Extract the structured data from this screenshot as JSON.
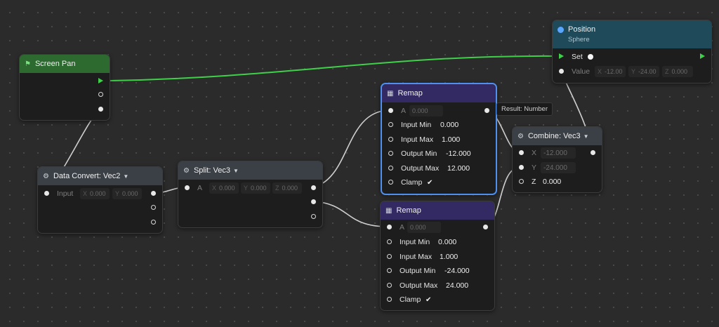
{
  "nodes": {
    "screen_pan": {
      "title": "Screen Pan"
    },
    "data_convert": {
      "title": "Data Convert: Vec2",
      "input_label": "Input",
      "x_label": "X",
      "x_value": "0.000",
      "y_label": "Y",
      "y_value": "0.000"
    },
    "split": {
      "title": "Split: Vec3",
      "a_label": "A",
      "x_label": "X",
      "x_value": "0.000",
      "y_label": "Y",
      "y_value": "0.000",
      "z_label": "Z",
      "z_value": "0.000"
    },
    "remap1": {
      "title": "Remap",
      "a_label": "A",
      "a_value": "0.000",
      "input_min_label": "Input Min",
      "input_min": "0.000",
      "input_max_label": "Input Max",
      "input_max": "1.000",
      "output_min_label": "Output Min",
      "output_min": "-12.000",
      "output_max_label": "Output Max",
      "output_max": "12.000",
      "clamp_label": "Clamp",
      "clamp_check": "✔"
    },
    "remap2": {
      "title": "Remap",
      "a_label": "A",
      "a_value": "0.000",
      "input_min_label": "Input Min",
      "input_min": "0.000",
      "input_max_label": "Input Max",
      "input_max": "1.000",
      "output_min_label": "Output Min",
      "output_min": "-24.000",
      "output_max_label": "Output Max",
      "output_max": "24.000",
      "clamp_label": "Clamp",
      "clamp_check": "✔"
    },
    "combine": {
      "title": "Combine: Vec3",
      "x_label": "X",
      "x_value": "-12.000",
      "y_label": "Y",
      "y_value": "-24.000",
      "z_label": "Z",
      "z_value": "0.000"
    },
    "position": {
      "title": "Position",
      "subtitle": "Sphere",
      "set_label": "Set",
      "value_label": "Value",
      "x_label": "X",
      "x_value": "-12.00",
      "y_label": "Y",
      "y_value": "-24.00",
      "z_label": "Z",
      "z_value": "0.000"
    }
  },
  "tooltip": {
    "text": "Result: Number"
  },
  "icons": {
    "screen_pan": "flag-icon",
    "data_convert": "gear-icon",
    "split": "gear-icon",
    "remap": "calculator-icon",
    "combine": "gear-icon",
    "position": "target-icon",
    "dropdown": "chevron-down-icon"
  },
  "colors": {
    "background": "#2b2b2b",
    "node_body": "#1d1d1d",
    "flow_wire": "#3fd04a",
    "data_wire": "#d8d8d8",
    "header_event": "#2c6a2f",
    "header_utility": "#3b4047",
    "header_math": "#332a63",
    "header_target": "#1f4a5a",
    "selection": "#4f8ff0"
  }
}
